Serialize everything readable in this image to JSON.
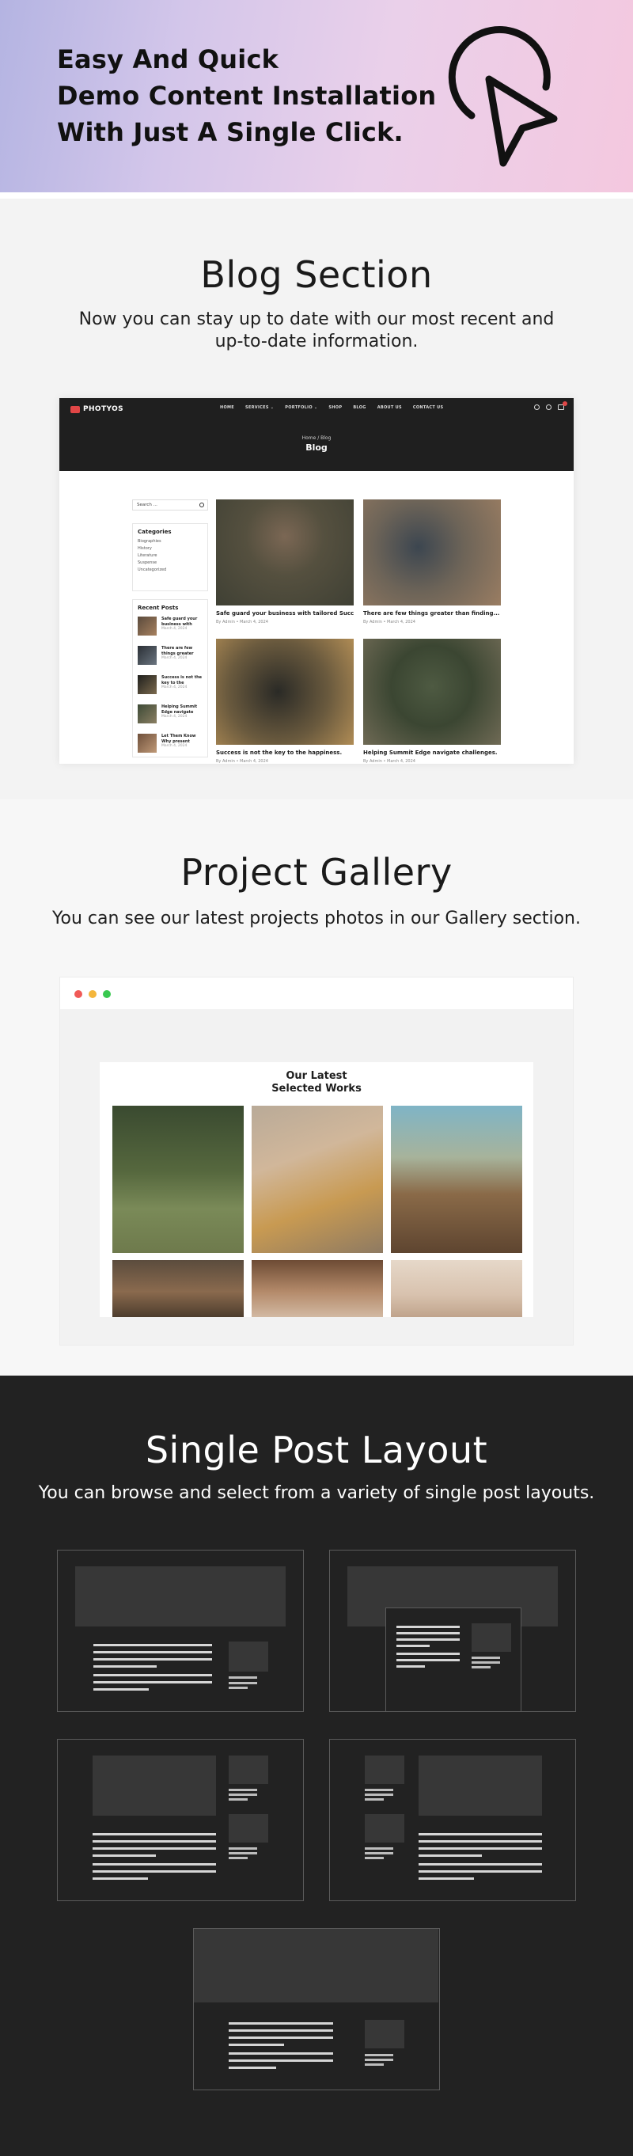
{
  "hero": {
    "title_lines": [
      "Easy And Quick",
      "Demo Content Installation",
      "With Just A Single Click."
    ],
    "icon": "cursor-click-icon"
  },
  "blog": {
    "title": "Blog Section",
    "subtitle_lines": [
      "Now you can stay up to date with our most recent and",
      "up-to-date information."
    ],
    "mock": {
      "logo": "PHOTYOS",
      "nav": [
        "HOME",
        "SERVICES ⌄",
        "PORTFOLIO ⌄",
        "SHOP",
        "BLOG",
        "ABOUT US",
        "CONTACT US"
      ],
      "breadcrumb": "Home / Blog",
      "page_title": "Blog",
      "search_placeholder": "Search ...",
      "categories_heading": "Categories",
      "categories": [
        "Biographies",
        "History",
        "Literature",
        "Suspense",
        "Uncategorized"
      ],
      "recent_heading": "Recent Posts",
      "recent_posts": [
        {
          "title": "Safe guard your business with",
          "date": "March 4, 2024"
        },
        {
          "title": "There are few things greater",
          "date": "March 4, 2024"
        },
        {
          "title": "Success is not the key to the",
          "date": "March 4, 2024"
        },
        {
          "title": "Helping Summit Edge navigate",
          "date": "March 4, 2024"
        },
        {
          "title": "Let Them Know Why present",
          "date": "March 4, 2024"
        }
      ],
      "posts": [
        {
          "title": "Safe guard your business with tailored Success.",
          "meta": "By Admin • March 4, 2024"
        },
        {
          "title": "There are few things greater than finding...",
          "meta": "By Admin • March 4, 2024"
        },
        {
          "title": "Success is not the key to the happiness.",
          "meta": "By Admin • March 4, 2024"
        },
        {
          "title": "Helping Summit Edge navigate challenges.",
          "meta": "By Admin • March 4, 2024"
        }
      ]
    }
  },
  "gallery": {
    "title": "Project Gallery",
    "subtitle": "You can see our latest projects photos in our Gallery section.",
    "heading_lines": [
      "Our Latest",
      "Selected Works"
    ],
    "window_dot_colors": [
      "#f05a57",
      "#f4b63c",
      "#39c850"
    ]
  },
  "single": {
    "title": "Single Post Layout",
    "subtitle": "You can browse and select from a variety of single post layouts."
  }
}
